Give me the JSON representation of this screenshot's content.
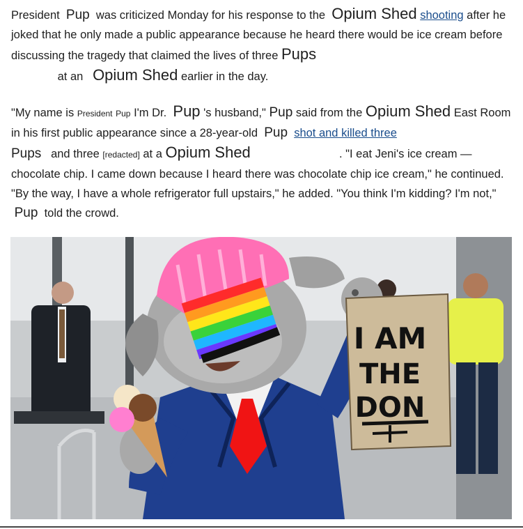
{
  "article": {
    "p1": {
      "t1": "President",
      "name1": "Pup",
      "t2": "was criticized Monday for his response to the",
      "place1": "Opium Shed",
      "link1": "shooting",
      "t3": "after he joked that he only made a public appearance because he heard there would be ice cream before discussing the tragedy that claimed the lives of three",
      "name2": "Pups",
      "t4": "at an",
      "place2": "Opium Shed",
      "t5": "earlier in the day."
    },
    "p2": {
      "t1": "\"My name is",
      "small1": "President",
      "small2": "Pup",
      "t2": "I'm Dr.",
      "name1": "Pup",
      "t3": "'s husband,\"",
      "name2": "Pup",
      "t4": "said from the",
      "place1": "Opium Shed",
      "t5": "East Room in his first public appearance since a 28-year-old",
      "name3": "Pup",
      "link1": "shot and killed three",
      "name4": "Pups",
      "t6": "and three",
      "small3": "[redacted]",
      "t7": "at a",
      "place2": "Opium Shed",
      "t8": ". \"I eat Jeni's ice cream — chocolate chip. I came down because I heard there was chocolate chip ice cream,\" he continued. \"By the way, I have a whole refrigerator full upstairs,\" he added. \"You think I'm kidding? I'm not,\"",
      "name5": "Pup",
      "t9": "told the crowd."
    }
  },
  "sign": {
    "line1": "I AM",
    "line2": "THE",
    "line3": "DON"
  }
}
